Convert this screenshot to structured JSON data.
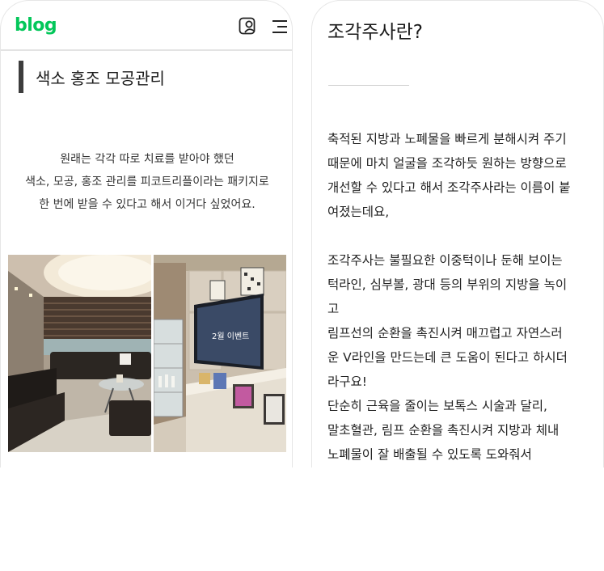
{
  "left": {
    "logo": "blog",
    "post_title": "색소 홍조 모공관리",
    "intro_lines": [
      "원래는 각각 따로 치료를 받아야 했던",
      "색소, 모공, 홍조 관리를 피코트리플이라는 패키지로",
      "한 번에 받을 수 있다고 해서 이거다 싶었어요."
    ],
    "photo_left": "clinic-waiting-lounge-photo",
    "photo_right": "clinic-reception-tv-photo",
    "tv_text": "2월 이벤트"
  },
  "right": {
    "section_title": "조각주사란?",
    "lines": [
      "축적된 지방과 노폐물을 빠르게 분해시켜 주기",
      "때문에 마치 얼굴을 조각하듯 원하는 방향으로",
      "개선할 수 있다고 해서 조각주사라는 이름이 붙",
      "여졌는데요,",
      "",
      "조각주사는 불필요한 이중턱이나 둔해 보이는",
      "턱라인, 심부볼, 광대 등의 부위의 지방을 녹이",
      "고",
      "림프선의 순환을 촉진시켜 매끄럽고 자연스러",
      "운 V라인을 만드는데 큰 도움이 된다고 하시더",
      "라구요!",
      "단순히 근육을 줄이는 보톡스 시술과 달리,",
      "말초혈관, 림프 순환을 촉진시켜 지방과 체내",
      "노폐물이 잘 배출될 수 있도록 도와줘서"
    ]
  },
  "icons": [
    "profile-edit-icon",
    "menu-icon"
  ],
  "colors": {
    "brand": "#03c75a",
    "title_bar": "#3d3d3d"
  }
}
